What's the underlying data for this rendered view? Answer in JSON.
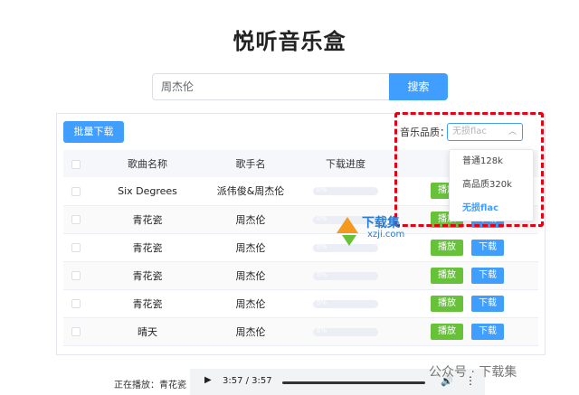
{
  "app": {
    "title": "悦听音乐盒"
  },
  "search": {
    "value": "周杰伦",
    "button_label": "搜索"
  },
  "toolbar": {
    "batch_download_label": "批量下载"
  },
  "quality": {
    "label": "音乐品质：",
    "selected": "无损flac",
    "options": [
      "普通128k",
      "高品质320k",
      "无损flac"
    ]
  },
  "table": {
    "headers": [
      "歌曲名称",
      "歌手名",
      "下载进度"
    ],
    "rows": [
      {
        "song": "Six Degrees",
        "artist": "派伟俊&周杰伦",
        "progress": "0%"
      },
      {
        "song": "青花瓷",
        "artist": "周杰伦",
        "progress": "0%"
      },
      {
        "song": "青花瓷",
        "artist": "周杰伦",
        "progress": "0%"
      },
      {
        "song": "青花瓷",
        "artist": "周杰伦",
        "progress": "0%"
      },
      {
        "song": "青花瓷",
        "artist": "周杰伦",
        "progress": "0%"
      },
      {
        "song": "晴天",
        "artist": "周杰伦",
        "progress": "0%"
      }
    ],
    "play_label": "播放",
    "download_label": "下载"
  },
  "watermark": {
    "text": "下载集",
    "sub": "xzji.com"
  },
  "player": {
    "now_playing": "正在播放：青花瓷",
    "time": "3:57 / 3:57"
  },
  "footer_watermark": "公众号 · 下载集",
  "colors": {
    "primary": "#409eff",
    "success": "#67c23a",
    "highlight": "#e60012"
  }
}
